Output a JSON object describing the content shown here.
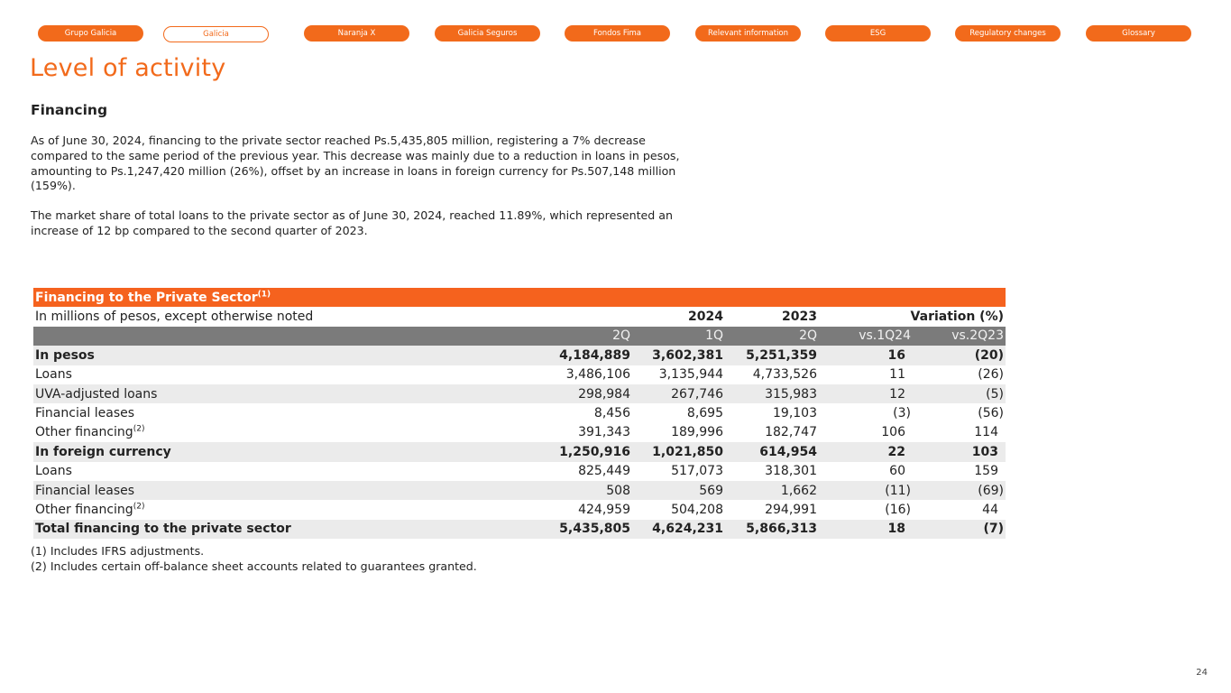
{
  "nav": {
    "items": [
      {
        "label": "Grupo Galicia"
      },
      {
        "label": "Galicia"
      },
      {
        "label": "Naranja X"
      },
      {
        "label": "Galicia Seguros"
      },
      {
        "label": "Fondos Fima"
      },
      {
        "label": "Relevant information"
      },
      {
        "label": "ESG"
      },
      {
        "label": "Regulatory changes"
      },
      {
        "label": "Glossary"
      }
    ],
    "active": "Galicia"
  },
  "page": {
    "title": "Level of activity",
    "section_title": "Financing",
    "paragraph1": "As of June 30, 2024, financing to the private sector reached Ps.5,435,805 million, registering a 7% decrease compared to the same period of the previous year. This decrease was mainly due to a reduction in loans in pesos, amounting to Ps.1,247,420 million (26%), offset by an increase in loans in foreign currency for Ps.507,148 million (159%).",
    "paragraph2": "The market share of total loans to the private sector as of June 30, 2024, reached 11.89%, which represented an increase of 12 bp compared to the second quarter of 2023.",
    "page_number": "24"
  },
  "table": {
    "title": "Financing to the Private Sector",
    "title_note": "(1)",
    "subtitle": "In millions of pesos, except otherwise noted",
    "year_2024": "2024",
    "year_2023": "2023",
    "variation": "Variation (%)",
    "columns": [
      "2Q",
      "1Q",
      "2Q",
      "vs.1Q24",
      "vs.2Q23"
    ],
    "rows": [
      {
        "label": "In pesos",
        "note": "",
        "values": [
          "4,184,889",
          "3,602,381",
          "5,251,359",
          "16",
          "(20)"
        ]
      },
      {
        "label": "Loans",
        "note": "",
        "values": [
          "3,486,106",
          "3,135,944",
          "4,733,526",
          "11",
          "(26)"
        ]
      },
      {
        "label": "UVA-adjusted loans",
        "note": "",
        "values": [
          "298,984",
          "267,746",
          "315,983",
          "12",
          "(5)"
        ]
      },
      {
        "label": "Financial leases",
        "note": "",
        "values": [
          "8,456",
          "8,695",
          "19,103",
          "(3)",
          "(56)"
        ]
      },
      {
        "label": "Other financing",
        "note": "(2)",
        "values": [
          "391,343",
          "189,996",
          "182,747",
          "106",
          "114"
        ]
      },
      {
        "label": "In foreign currency",
        "note": "",
        "values": [
          "1,250,916",
          "1,021,850",
          "614,954",
          "22",
          "103"
        ]
      },
      {
        "label": "Loans",
        "note": "",
        "values": [
          "825,449",
          "517,073",
          "318,301",
          "60",
          "159"
        ]
      },
      {
        "label": "Financial leases",
        "note": "",
        "values": [
          "508",
          "569",
          "1,662",
          "(11)",
          "(69)"
        ]
      },
      {
        "label": "Other financing",
        "note": "(2)",
        "values": [
          "424,959",
          "504,208",
          "294,991",
          "(16)",
          "44"
        ]
      },
      {
        "label": "Total financing to the private sector",
        "note": "",
        "values": [
          "5,435,805",
          "4,624,231",
          "5,866,313",
          "18",
          "(7)"
        ]
      }
    ]
  },
  "notes": [
    "(1) Includes IFRS adjustments.",
    "(2) Includes certain off-balance sheet accounts related to guarantees granted."
  ]
}
